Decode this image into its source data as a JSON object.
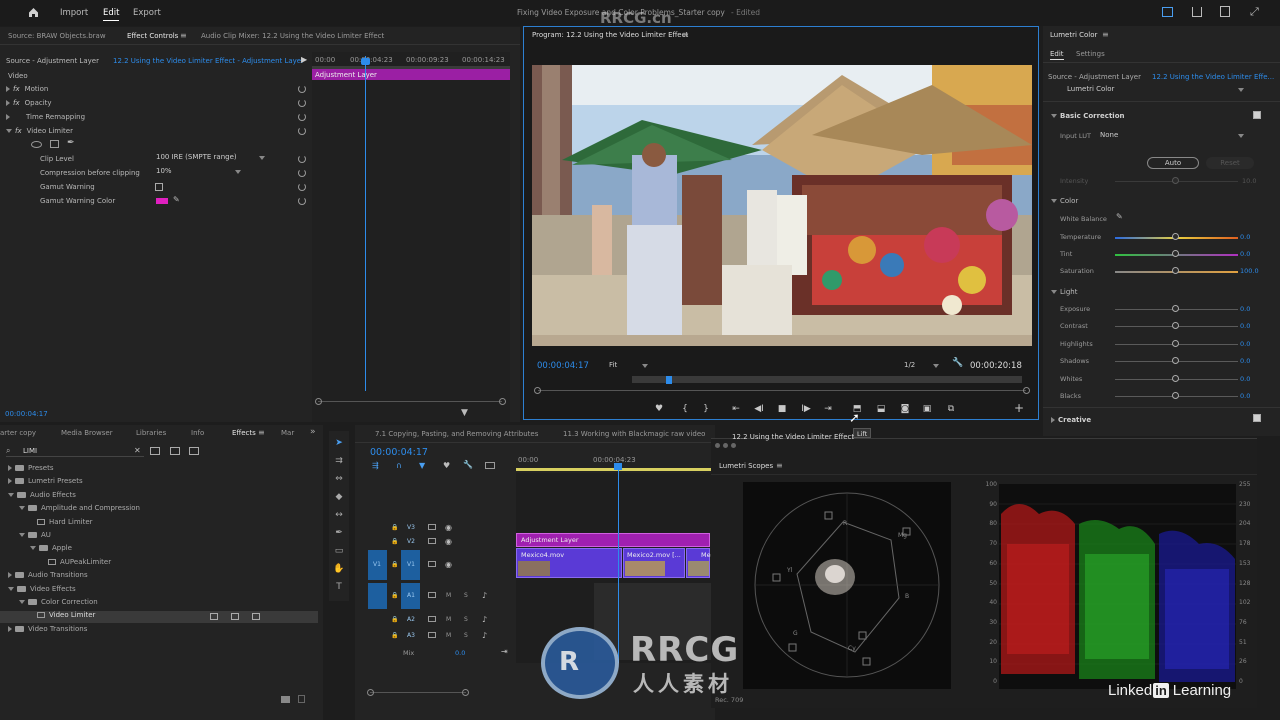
{
  "menubar": {
    "items": [
      "Import",
      "Edit",
      "Export"
    ],
    "active": "Edit",
    "project_title": "Fixing Video Exposure and Color Problems_Starter copy",
    "edited": "- Edited"
  },
  "effect_controls": {
    "tabs": {
      "source": "Source: BRAW Objects.braw",
      "active": "Effect Controls",
      "mixer": "Audio Clip Mixer: 12.2 Using the Video Limiter Effect"
    },
    "source_label": "Source - Adjustment Layer",
    "sequence_label": "12.2 Using the Video Limiter Effect - Adjustment Layer",
    "ruler": [
      "00:00",
      "00:00:04:23",
      "00:00:09:23",
      "00:00:14:23"
    ],
    "clip_label": "Adjustment Layer",
    "section": "Video",
    "effects": [
      "Motion",
      "Opacity",
      "Time Remapping",
      "Video Limiter"
    ],
    "props": [
      {
        "label": "Clip Level",
        "value": "100 IRE (SMPTE range)"
      },
      {
        "label": "Compression before clipping",
        "value": "10%"
      },
      {
        "label": "Gamut Warning",
        "value": ""
      },
      {
        "label": "Gamut Warning Color",
        "value": ""
      }
    ],
    "timecode": "00:00:04:17",
    "gamut_color": "#e020c0"
  },
  "program": {
    "title": "Program: 12.2 Using the Video Limiter Effect",
    "timecode": "00:00:04:17",
    "fit": "Fit",
    "resolution": "1/2",
    "duration": "00:00:20:18",
    "tooltip": "Lift"
  },
  "lumetri": {
    "title": "Lumetri Color",
    "tabs": [
      "Edit",
      "Settings"
    ],
    "source_label": "Source - Adjustment Layer",
    "sequence_label": "12.2 Using the Video Limiter Effe...",
    "preset": "Lumetri Color",
    "basic": "Basic Correction",
    "input_lut_label": "Input LUT",
    "input_lut": "None",
    "auto": "Auto",
    "reset": "Reset",
    "intensity_label": "Intensity",
    "intensity_value": "10.0",
    "color_section": "Color",
    "white_balance": "White Balance",
    "color_rows": [
      {
        "label": "Temperature",
        "value": "0.0"
      },
      {
        "label": "Tint",
        "value": "0.0"
      },
      {
        "label": "Saturation",
        "value": "100.0"
      }
    ],
    "light_section": "Light",
    "light_rows": [
      {
        "label": "Exposure",
        "value": "0.0"
      },
      {
        "label": "Contrast",
        "value": "0.0"
      },
      {
        "label": "Highlights",
        "value": "0.0"
      },
      {
        "label": "Shadows",
        "value": "0.0"
      },
      {
        "label": "Whites",
        "value": "0.0"
      },
      {
        "label": "Blacks",
        "value": "0.0"
      }
    ],
    "creative": "Creative"
  },
  "effects_panel": {
    "tabs": [
      "arter copy",
      "Media Browser",
      "Libraries",
      "Info",
      "Effects",
      "Mar"
    ],
    "active": "Effects",
    "search": "LIMI",
    "tree": [
      {
        "label": "Presets",
        "indent": 0,
        "type": "folder"
      },
      {
        "label": "Lumetri Presets",
        "indent": 0,
        "type": "folder"
      },
      {
        "label": "Audio Effects",
        "indent": 0,
        "type": "folder"
      },
      {
        "label": "Amplitude and Compression",
        "indent": 1,
        "type": "folder"
      },
      {
        "label": "Hard Limiter",
        "indent": 2,
        "type": "effect"
      },
      {
        "label": "AU",
        "indent": 1,
        "type": "folder"
      },
      {
        "label": "Apple",
        "indent": 2,
        "type": "folder"
      },
      {
        "label": "AUPeakLimiter",
        "indent": 3,
        "type": "effect"
      },
      {
        "label": "Audio Transitions",
        "indent": 0,
        "type": "folder"
      },
      {
        "label": "Video Effects",
        "indent": 0,
        "type": "folder"
      },
      {
        "label": "Color Correction",
        "indent": 1,
        "type": "folder"
      },
      {
        "label": "Video Limiter",
        "indent": 2,
        "type": "effect"
      },
      {
        "label": "Video Transitions",
        "indent": 0,
        "type": "folder"
      }
    ]
  },
  "timeline": {
    "tabs": [
      "7.1 Copying, Pasting, and Removing Attributes",
      "11.3 Working with Blackmagic raw video",
      "12.2 Using the Video Limiter Effect"
    ],
    "timecode": "00:00:04:17",
    "ruler": [
      "00:00",
      "00:00:04:23"
    ],
    "tracks": [
      "V3",
      "V2",
      "V1",
      "A1",
      "A2",
      "A3"
    ],
    "mix_label": "Mix",
    "mix_value": "0.0",
    "clips": {
      "adjust": "Adjustment Layer",
      "clip1": "Mexico4.mov",
      "clip2": "Mexico2.mov [...",
      "clip3": "Me"
    }
  },
  "scopes": {
    "title": "Lumetri Scopes",
    "footer": "Rec. 709",
    "vector_labels": [
      "R",
      "Mg",
      "B",
      "Cy",
      "G",
      "Yl"
    ],
    "scale_left": [
      "100",
      "90",
      "80",
      "70",
      "60",
      "50",
      "40",
      "30",
      "20",
      "10",
      "0"
    ],
    "scale_right": [
      "255",
      "230",
      "204",
      "178",
      "153",
      "128",
      "102",
      "76",
      "51",
      "26",
      "0"
    ]
  },
  "watermarks": {
    "center": "RRCG.cn",
    "brand": "RRCG",
    "brand_sub": "人人素材",
    "linkedin": "Linked",
    "linkedin_in": "in",
    "learning": "Learning"
  }
}
